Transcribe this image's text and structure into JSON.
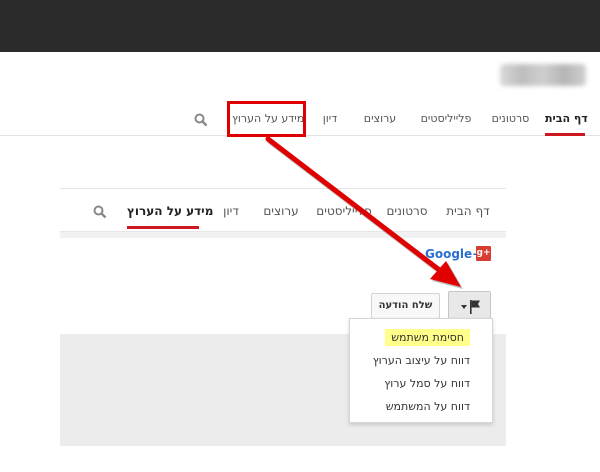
{
  "header": {
    "tabs": [
      {
        "label": "דף הבית",
        "active": true
      },
      {
        "label": "סרטונים",
        "active": false
      },
      {
        "label": "פלייליסטים",
        "active": false
      },
      {
        "label": "ערוצים",
        "active": false
      },
      {
        "label": "דיון",
        "active": false
      },
      {
        "label": "מידע על הערוץ",
        "active": false
      }
    ],
    "search_icon": "search-icon"
  },
  "panel": {
    "tabs": [
      {
        "label": "דף הבית",
        "active": false
      },
      {
        "label": "סרטונים",
        "active": false
      },
      {
        "label": "פלייליסטים",
        "active": false
      },
      {
        "label": "ערוצים",
        "active": false
      },
      {
        "label": "דיון",
        "active": false
      },
      {
        "label": "מידע על הערוץ",
        "active": true
      }
    ],
    "search_icon": "search-icon"
  },
  "about": {
    "gplus_label": "Google+",
    "gplus_icon_text": "g+",
    "send_message": "שלח הודעה",
    "flag_icon": "flag-icon"
  },
  "menu": {
    "items": [
      {
        "label": "חסימת משתמש",
        "highlighted": true
      },
      {
        "label": "דווח על עיצוב הערוץ",
        "highlighted": false
      },
      {
        "label": "דווח על סמל ערוץ",
        "highlighted": false
      },
      {
        "label": "דווח על המשתמש",
        "highlighted": false
      }
    ]
  },
  "colors": {
    "accent_red": "#cc181e",
    "annotation_red": "#e00000",
    "highlight_yellow": "#ffff8a",
    "topbar": "#2b2b2b"
  }
}
